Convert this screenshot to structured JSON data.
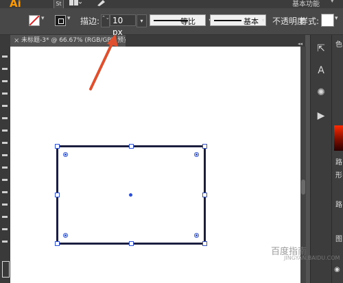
{
  "app": {
    "logo": "Ai",
    "st_badge": "St",
    "workspace": "基本功能",
    "workspace_chevron": "▾"
  },
  "control_bar": {
    "stroke_label": "描边:",
    "stroke_stepper": "⌃⌄",
    "stroke_value": "10 px",
    "stroke_dropdown": "▾",
    "profile_label": "等比",
    "brush_label": "基本",
    "opacity_label": "不透明度",
    "style_label": "样式:",
    "dropdown_chevron": "▾"
  },
  "tab": {
    "title": "未标题-3* @ 66.67% (RGB/GPU 预览)",
    "close_glyph": "×"
  },
  "panel_collapse": "◂◂",
  "right_panel": {
    "color_label": "色",
    "label2": "路",
    "label3": "形",
    "label4": "路",
    "label5": "图"
  },
  "watermark": {
    "text": "百度指南",
    "sub": "JINGYAN.BAIDU.COM"
  },
  "colors": {
    "accent_arrow": "#e0502e",
    "selection_blue": "#2d4fd6",
    "stroke_color": "#1b1e3f",
    "logo_orange": "#ff9a00"
  },
  "icons": [
    "arrow-annotation-icon",
    "export-icon",
    "type-icon",
    "sun-icon",
    "play-icon",
    "eye-icon"
  ]
}
